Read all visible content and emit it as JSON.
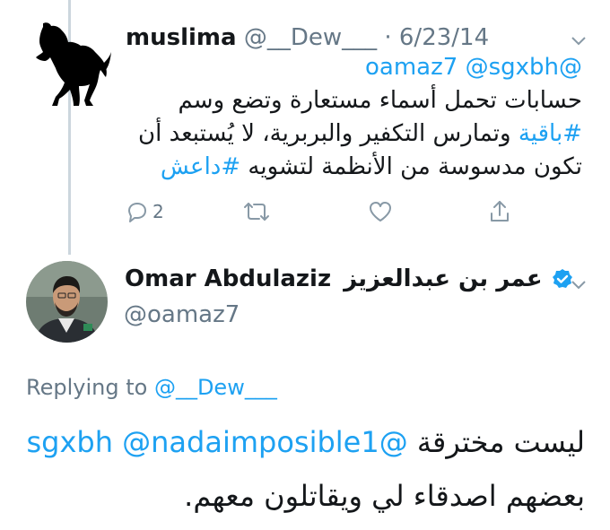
{
  "parent_tweet": {
    "display_name": "muslima",
    "handle": "@__Dew___",
    "separator": "·",
    "date": "6/23/14",
    "mentions": "@oamaz7 @sgxbh",
    "line1": "حسابات تحمل أسماء مستعارة وتضع وسم",
    "line2_hashtag": "#باقية",
    "line2_text": " وتمارس التكفير والبربرية، لا يُستبعد أن",
    "line3_text": "تكون مدسوسة من الأنظمة لتشويه ",
    "line3_hashtag": "#داعش",
    "reply_count": "2"
  },
  "reply_tweet": {
    "display_name_en": "Omar Abdulaziz",
    "display_name_ar": "عمر بن عبدالعزيز",
    "handle": "@oamaz7",
    "replying_prefix": "Replying to",
    "replying_handle": "@__Dew___",
    "line1_text": "ليست مخترقة ",
    "line1_mention_a": "@sgxbh",
    "line1_mention_b": "@nadaimposible1",
    "line2_text": "بعضهم اصدقاء لي ويقاتلون معهم."
  },
  "icons": {
    "avatar_parent": "black-horse-icon",
    "avatar_reply": "profile-photo",
    "verified": "verified-badge-icon",
    "menu": "chevron-down-icon",
    "reply": "reply-icon",
    "retweet": "retweet-icon",
    "like": "heart-icon",
    "share": "share-icon"
  },
  "colors": {
    "link": "#1da1f2",
    "secondary_text": "#657786",
    "thread_line": "#ccd6dd",
    "verified": "#1da1f2"
  }
}
